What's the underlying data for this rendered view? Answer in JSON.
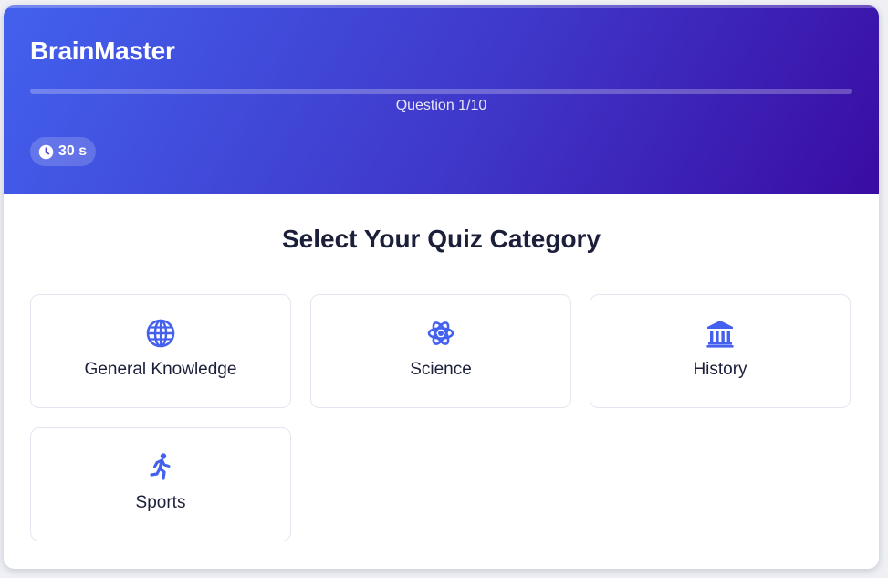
{
  "header": {
    "app_title": "BrainMaster",
    "question_counter": "Question 1/10",
    "progress_fraction": 0.0,
    "timer_label": "30 s"
  },
  "main": {
    "section_title": "Select Your Quiz Category",
    "categories": [
      {
        "label": "General Knowledge",
        "icon": "globe-icon"
      },
      {
        "label": "Science",
        "icon": "atom-icon"
      },
      {
        "label": "History",
        "icon": "landmark-icon"
      },
      {
        "label": "Sports",
        "icon": "running-person-icon"
      }
    ]
  },
  "colors": {
    "accent": "#4361ee",
    "gradient_start": "#4361ee",
    "gradient_end": "#3a0ca3",
    "text_dark": "#1b1f3a"
  }
}
